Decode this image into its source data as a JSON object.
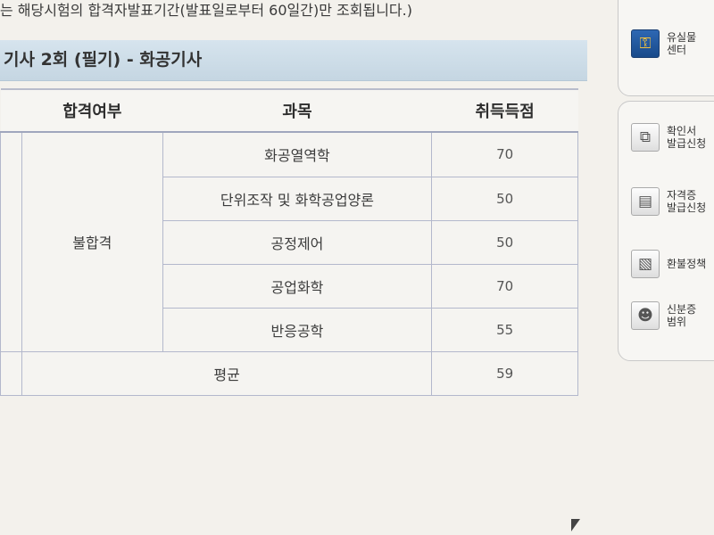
{
  "notice": "는 해당시험의 합격자발표기간(발표일로부터 60일간)만 조회됩니다.)",
  "exam_title": "기사 2회 (필기) - 화공기사",
  "table": {
    "headers": [
      "합격여부",
      "과목",
      "취득득점"
    ],
    "status": "불합격",
    "rows": [
      {
        "subject": "화공열역학",
        "score": "70"
      },
      {
        "subject": "단위조작 및 화학공업양론",
        "score": "50"
      },
      {
        "subject": "공정제어",
        "score": "50"
      },
      {
        "subject": "공업화학",
        "score": "70"
      },
      {
        "subject": "반응공학",
        "score": "55"
      }
    ],
    "average_label": "평균",
    "average_score": "59"
  },
  "sidebar": {
    "top_item": {
      "label": "유실물\n센터",
      "icon": "key-icon"
    },
    "items": [
      {
        "label": "확인서\n발급신청",
        "icon": "document-copy-icon"
      },
      {
        "label": "자격증\n발급신청",
        "icon": "certificate-icon"
      },
      {
        "label": "환불정책",
        "icon": "receipt-icon"
      },
      {
        "label": "신분증\n범위",
        "icon": "id-card-icon"
      }
    ]
  },
  "colors": {
    "title_bar": "#c5d6e2",
    "table_border": "#b3b8cc",
    "background": "#f3f1ec"
  }
}
